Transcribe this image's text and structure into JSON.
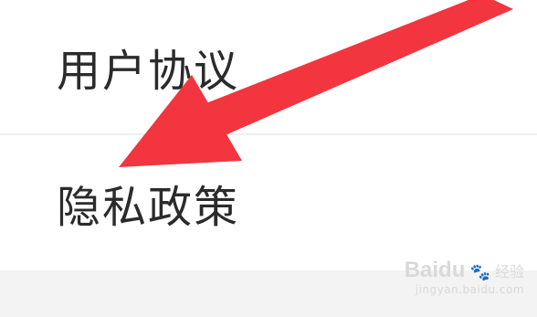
{
  "menu": {
    "items": [
      {
        "label": "用户协议"
      },
      {
        "label": "隐私政策"
      }
    ]
  },
  "watermark": {
    "brand": "Baidu",
    "sub": "经验",
    "url": "jingyan.baidu.com"
  },
  "annotation": {
    "arrow_color": "#f2353f",
    "points_to": "隐私政策"
  }
}
